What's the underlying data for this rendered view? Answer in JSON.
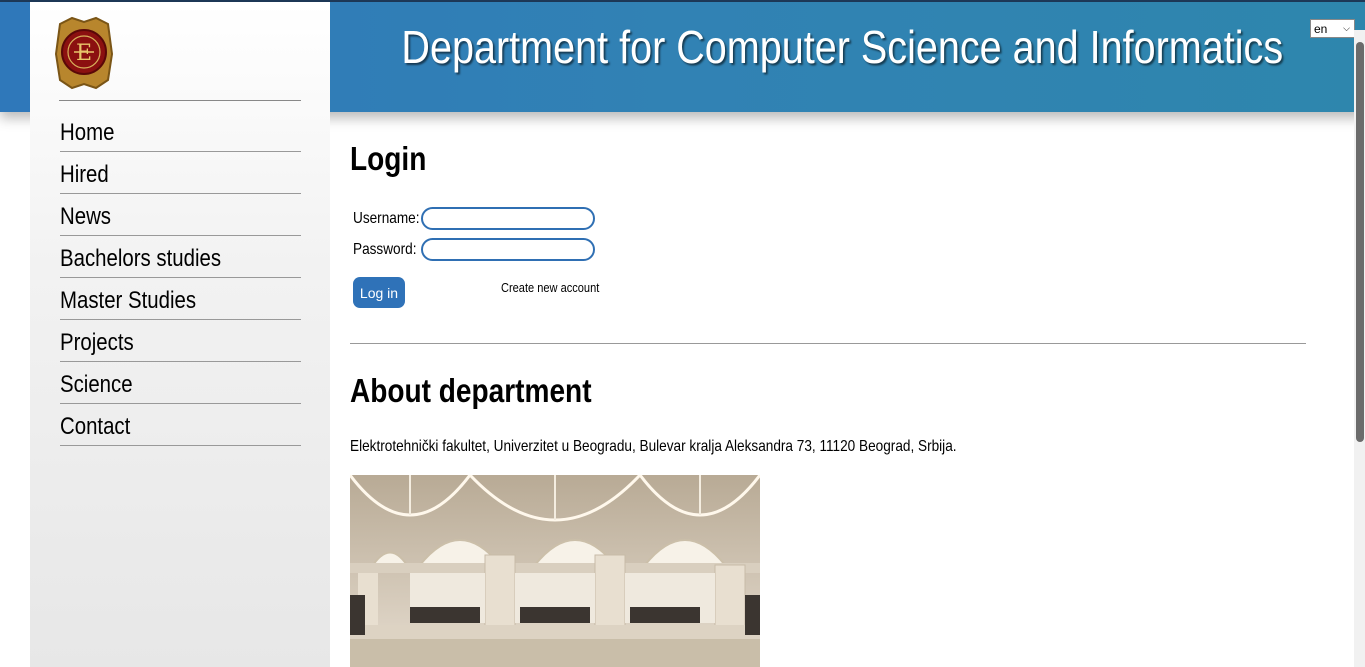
{
  "header": {
    "title": "Department for Computer Science and Informatics",
    "language": {
      "selected": "en"
    }
  },
  "sidebar": {
    "logo": "faculty-emblem",
    "nav": [
      {
        "label": "Home"
      },
      {
        "label": "Hired"
      },
      {
        "label": "News"
      },
      {
        "label": "Bachelors studies"
      },
      {
        "label": "Master Studies"
      },
      {
        "label": "Projects"
      },
      {
        "label": "Science"
      },
      {
        "label": "Contact"
      }
    ]
  },
  "login": {
    "heading": "Login",
    "username_label": "Username:",
    "username_value": "",
    "password_label": "Password:",
    "password_value": "",
    "button_label": "Log in",
    "create_account_label": "Create new account"
  },
  "about": {
    "heading": "About department",
    "address": "Elektrotehnički fakultet, Univerzitet u Beogradu, Bulevar kralja Aleksandra 73, 11120 Beograd, Srbija."
  },
  "colors": {
    "header_blue": "#2f78ba",
    "button_blue": "#2f72b8",
    "input_border": "#2f6fb3"
  }
}
